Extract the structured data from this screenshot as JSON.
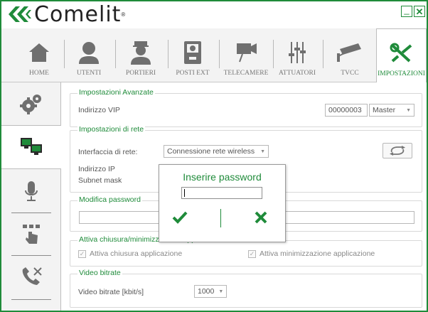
{
  "app": {
    "logo_text": "Comelit",
    "logo_tm": "®",
    "minimize_glyph": "_",
    "close_glyph": "✕"
  },
  "colors": {
    "accent": "#1f8b3a",
    "icon_gray": "#6f6f6f",
    "active_icon": "#1f8b3a"
  },
  "topnav": {
    "items": [
      {
        "label": "HOME",
        "icon": "home-icon"
      },
      {
        "label": "UTENTI",
        "icon": "user-icon"
      },
      {
        "label": "PORTIERI",
        "icon": "doorman-icon"
      },
      {
        "label": "POSTI EXT",
        "icon": "door-station-icon"
      },
      {
        "label": "TELECAMERE",
        "icon": "camera-icon"
      },
      {
        "label": "ATTUATORI",
        "icon": "actuator-icon"
      },
      {
        "label": "TVCC",
        "icon": "cctv-icon"
      },
      {
        "label": "IMPOSTAZIONI",
        "icon": "tools-icon"
      }
    ],
    "active": "IMPOSTAZIONI"
  },
  "sidenav": {
    "items": [
      {
        "icon": "gears-icon"
      },
      {
        "icon": "network-icon"
      },
      {
        "icon": "microphone-icon"
      },
      {
        "icon": "touch-keypad-icon"
      },
      {
        "icon": "phone-tools-icon"
      }
    ],
    "active_index": 1
  },
  "advanced": {
    "title": "Impostazioni Avanzate",
    "vip_label": "Indirizzo VIP",
    "vip_value": "00000003",
    "role_value": "Master"
  },
  "network": {
    "title": "Impostazioni di rete",
    "interface_label": "Interfaccia di rete:",
    "interface_value": "Connessione rete wireless",
    "ip_label": "Indirizzo IP",
    "subnet_label": "Subnet mask"
  },
  "password": {
    "title": "Modifica password"
  },
  "closure": {
    "title": "Attiva chiusura/minimizzazione applicazione",
    "close_app_label": "Attiva chiusura applicazione",
    "minimize_app_label": "Attiva minimizzazione applicazione"
  },
  "bitrate": {
    "title": "Video bitrate",
    "label": "Video bitrate [kbit/s]",
    "value": "1000"
  },
  "dialog": {
    "title": "Inserire password",
    "input_value": ""
  }
}
